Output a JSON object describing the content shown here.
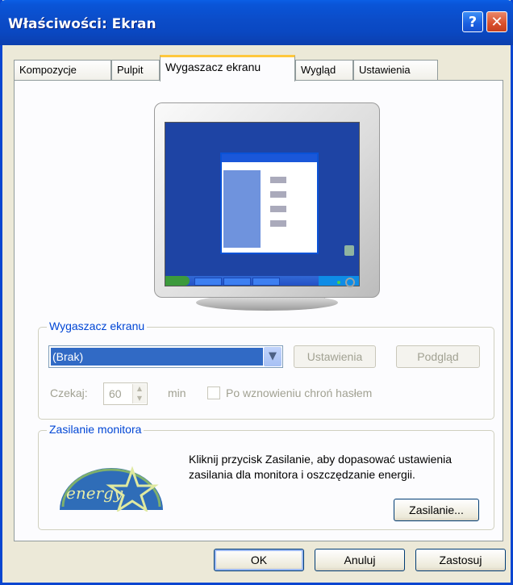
{
  "window": {
    "title": "Właściwości: Ekran",
    "help": "?",
    "close": "✕"
  },
  "tabs": [
    {
      "label": "Kompozycje"
    },
    {
      "label": "Pulpit"
    },
    {
      "label": "Wygaszacz ekranu"
    },
    {
      "label": "Wygląd"
    },
    {
      "label": "Ustawienia"
    }
  ],
  "screensaver": {
    "group_label": "Wygaszacz ekranu",
    "selected": "(Brak)",
    "settings_button": "Ustawienia",
    "preview_button": "Podgląd",
    "wait_label": "Czekaj:",
    "wait_value": "60",
    "wait_unit": "min",
    "password_checkbox": "Po wznowieniu chroń hasłem"
  },
  "power": {
    "group_label": "Zasilanie monitora",
    "description": "Kliknij przycisk Zasilanie, aby dopasować ustawienia zasilania dla monitora i oszczędzanie energii.",
    "button": "Zasilanie...",
    "logo_text": "energy"
  },
  "footer": {
    "ok": "OK",
    "cancel": "Anuluj",
    "apply": "Zastosuj"
  },
  "colors": {
    "titlebar": "#0a4cc8",
    "selection": "#316ac5",
    "group_label": "#0046d5",
    "active_tab_accent": "#ffc83c"
  }
}
